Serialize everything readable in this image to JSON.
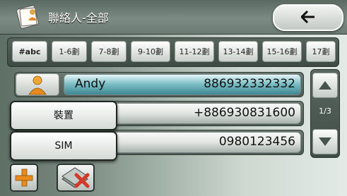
{
  "header": {
    "title": "聯絡人-全部",
    "back_icon": "arrow-left-icon"
  },
  "filter_tabs": [
    "#abc",
    "1-6劃",
    "7-8劃",
    "9-10劃",
    "11-12劃",
    "13-14劃",
    "15-16劃",
    "17劃"
  ],
  "contacts": [
    {
      "name": "Andy",
      "phone": "886932332332",
      "selected": true
    },
    {
      "name": "",
      "phone": "+886930831600",
      "selected": false
    },
    {
      "name": "",
      "phone": "0980123456",
      "selected": false
    }
  ],
  "popup_menu": {
    "items": [
      "裝置",
      "SIM"
    ]
  },
  "pagination": {
    "indicator": "1/3"
  },
  "toolbar": {
    "add_icon": "plus-icon",
    "delete_icon": "delete-cards-icon"
  },
  "colors": {
    "selected_row": "#3d8893",
    "accent_orange": "#e88a1c",
    "delete_red": "#d23a2a"
  }
}
